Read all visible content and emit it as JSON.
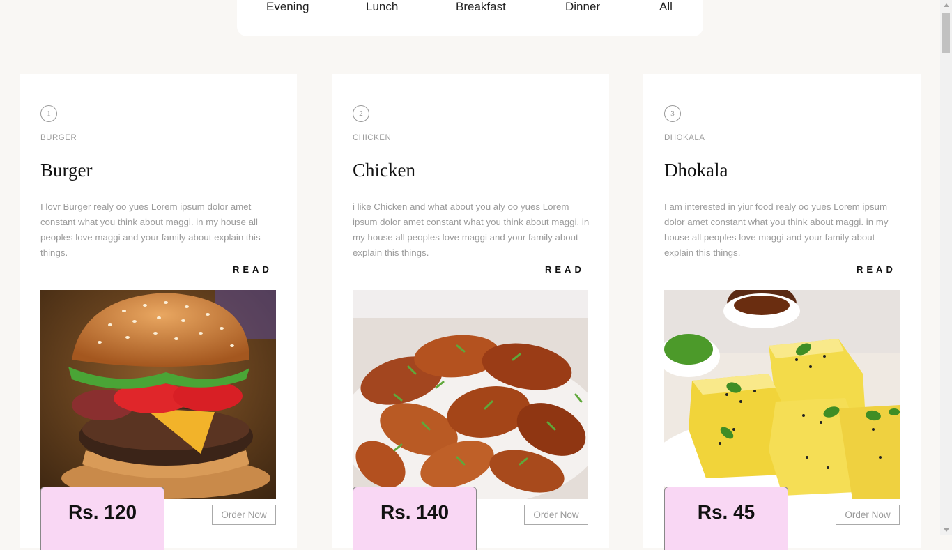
{
  "tabs": [
    "Evening",
    "Lunch",
    "Breakfast",
    "Dinner",
    "All"
  ],
  "cards": [
    {
      "number": "1",
      "category": "BURGER",
      "title": "Burger",
      "description": "I lovr Burger realy oo yues Lorem ipsum dolor amet constant what you think about maggi. in my house all peoples love maggi and your family about explain this things.",
      "read_label": "READ",
      "price": "Rs. 120",
      "order_label": "Order Now"
    },
    {
      "number": "2",
      "category": "CHICKEN",
      "title": "Chicken",
      "description": "i like Chicken and what about you aly oo yues Lorem ipsum dolor amet constant what you think about maggi. in my house all peoples love maggi and your family about explain this things.",
      "read_label": "READ",
      "price": "Rs. 140",
      "order_label": "Order Now"
    },
    {
      "number": "3",
      "category": "DHOKALA",
      "title": "Dhokala",
      "description": "I am interested in yiur food realy oo yues Lorem ipsum dolor amet constant what you think about maggi. in my house all peoples love maggi and your family about explain this things.",
      "read_label": "READ",
      "price": "Rs. 45",
      "order_label": "Order Now"
    }
  ],
  "colors": {
    "page_bg": "#f9f7f4",
    "card_bg": "#ffffff",
    "price_bg": "#f9d7f4"
  }
}
